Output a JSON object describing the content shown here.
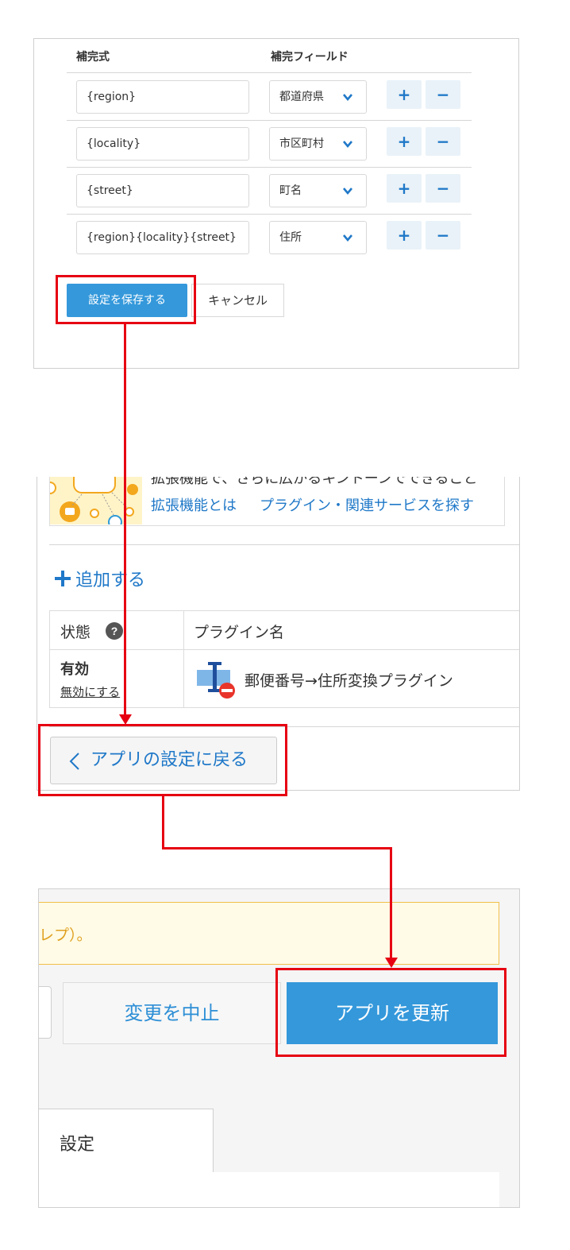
{
  "config": {
    "col_formula": "補完式",
    "col_field": "補完フィールド",
    "rows": [
      {
        "formula": "{region}",
        "field": "都道府県"
      },
      {
        "formula": "{locality}",
        "field": "市区町村"
      },
      {
        "formula": "{street}",
        "field": "町名"
      },
      {
        "formula": "{region}{locality}{street}",
        "field": "住所"
      }
    ],
    "plus": "+",
    "minus": "−",
    "save_label": "設定を保存する",
    "cancel_label": "キャンセル"
  },
  "plugins": {
    "banner_text_partial": "拡張機能で、さらに広がるキントーンでできること",
    "link_what": "拡張機能とは",
    "link_find": "プラグイン・関連サービスを探す",
    "add_label": "追加する",
    "col_status": "状態",
    "col_name": "プラグイン名",
    "status_value": "有効",
    "disable_link": "無効にする",
    "plugin_name": "郵便番号→住所変換プラグイン",
    "back_label": "アプリの設定に戻る"
  },
  "app": {
    "notice_partial": "レプ）。",
    "cancel_changes": "変更を中止",
    "update_app": "アプリを更新",
    "tab_settings": "設定"
  },
  "colors": {
    "accent_blue": "#3498db",
    "link_blue": "#1f78c8",
    "highlight_red": "#e60012",
    "notice_border": "#f0c14b"
  }
}
